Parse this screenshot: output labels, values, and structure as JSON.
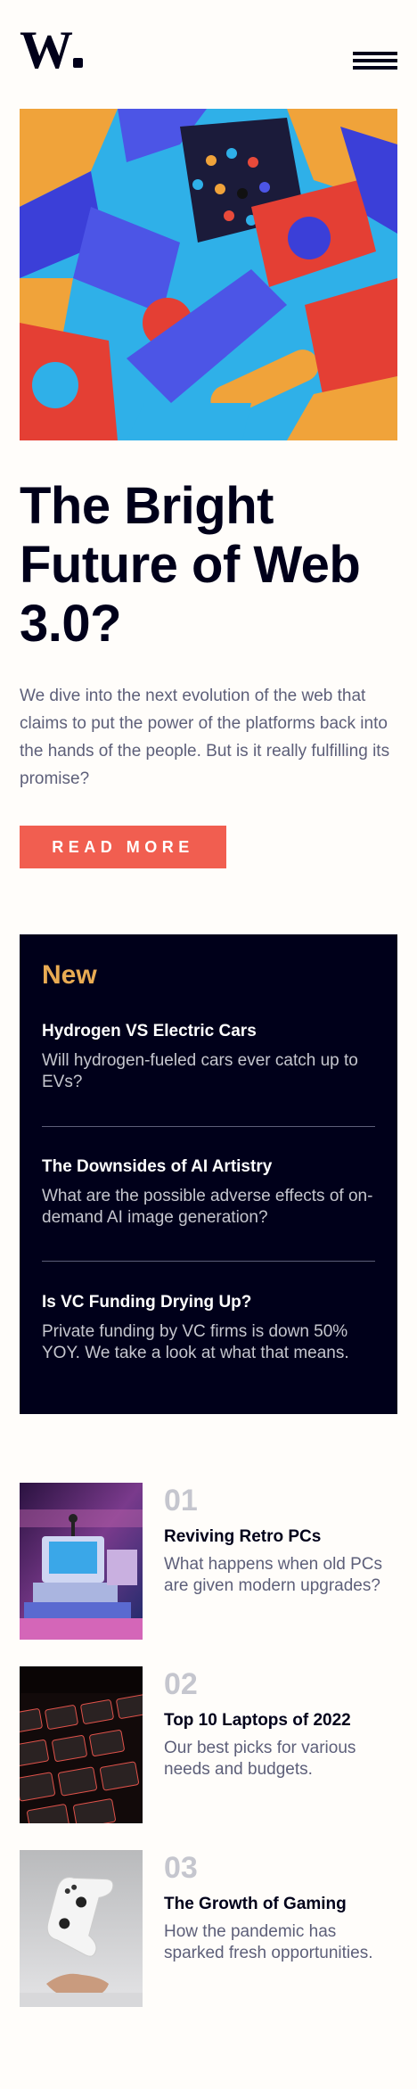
{
  "header": {
    "logo": "W",
    "menu_icon": "hamburger-menu-icon"
  },
  "hero": {
    "image": "abstract-3d-blocks-image",
    "title": "The Bright Future of Web 3.0?",
    "text": "We dive into the next evolution of the web that claims to put the power of the platforms back into the hands of the people. But is it really fulfilling its promise?",
    "button": "READ MORE"
  },
  "new_section": {
    "heading": "New",
    "items": [
      {
        "title": "Hydrogen VS Electric Cars",
        "text": "Will hydrogen-fueled cars ever catch up to EVs?"
      },
      {
        "title": "The Downsides of AI Artistry",
        "text": "What are the possible adverse effects of on-demand AI image generation?"
      },
      {
        "title": "Is VC Funding Drying Up?",
        "text": "Private funding by VC firms is down 50% YOY. We take a look at what that means."
      }
    ]
  },
  "articles": [
    {
      "number": "01",
      "title": "Reviving Retro PCs",
      "text": "What happens when old PCs are given modern upgrades?",
      "image": "retro-pc-image"
    },
    {
      "number": "02",
      "title": "Top 10 Laptops of 2022",
      "text": "Our best picks for various needs and budgets.",
      "image": "laptop-keyboard-image"
    },
    {
      "number": "03",
      "title": "The Growth of Gaming",
      "text": "How the pandemic has sparked fresh opportunities.",
      "image": "game-controller-image"
    }
  ],
  "colors": {
    "dark_navy": "#00001a",
    "soft_red": "#f15e50",
    "soft_orange": "#e9ab53",
    "grayish_blue": "#c5c6ce",
    "dark_grayish_blue": "#5d5f79",
    "off_white": "#fffdfa"
  }
}
